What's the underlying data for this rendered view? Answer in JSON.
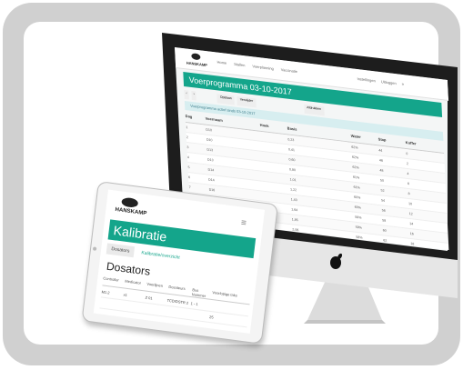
{
  "desktop": {
    "brand": "HANSKAMP",
    "nav": [
      "Home",
      "Stallen",
      "Voerplanning",
      "Vaccinatie"
    ],
    "header_right": [
      "Instellingen",
      "Uitloggen"
    ],
    "page_title": "Voerprogramma 03-10-2017",
    "toolbar_buttons": [
      "Opslaan",
      "Verwijder",
      "Afdrukken"
    ],
    "info_text": "Voerprogramma actief sinds 03-10-2017",
    "table": {
      "headers": [
        "Dag",
        "Voernaam",
        "Hoek",
        "Basis",
        "Water",
        "Stap",
        "Koffer"
      ],
      "rows": [
        [
          "1",
          "D10",
          "",
          "0,23",
          "62%",
          "44",
          "0"
        ],
        [
          "2",
          "D10",
          "",
          "0,41",
          "62%",
          "46",
          "2"
        ],
        [
          "3",
          "D13",
          "",
          "0,60",
          "62%",
          "48",
          "4"
        ],
        [
          "4",
          "D13",
          "",
          "0,80",
          "61%",
          "50",
          "6"
        ],
        [
          "5",
          "D14",
          "",
          "1,01",
          "61%",
          "52",
          "8"
        ],
        [
          "6",
          "D14",
          "",
          "1,22",
          "60%",
          "54",
          "10"
        ],
        [
          "7",
          "D16",
          "",
          "1,43",
          "60%",
          "56",
          "12"
        ],
        [
          "8",
          "D16",
          "",
          "1,64",
          "59%",
          "58",
          "14"
        ],
        [
          "9",
          "D18",
          "",
          "1,85",
          "59%",
          "60",
          "16"
        ],
        [
          "10",
          "D18",
          "",
          "2,06",
          "58%",
          "62",
          "18"
        ],
        [
          "11",
          "D20",
          "",
          "2,27",
          "58%",
          "64",
          "20"
        ]
      ]
    }
  },
  "tablet": {
    "brand": "HANSKAMP",
    "page_title": "Kalibratie",
    "tabs": [
      "Dosators",
      "Kalibratie/overzicht"
    ],
    "section_title": "Dosators",
    "table_headers": [
      "Controller",
      "Medicator",
      "Voerlijnen",
      "Dosateurs",
      "Bus Nummer",
      "Voorlopige taks"
    ],
    "table_rows": [
      [
        "M1.2",
        "x1",
        "Z 01",
        "TCD/DSTR 2",
        "1 - 1",
        ""
      ],
      [
        "",
        "",
        "",
        "",
        "",
        "25"
      ]
    ]
  },
  "colors": {
    "teal": "#14a58b",
    "dark": "#2b2b2b",
    "frame": "#d0d0d0"
  }
}
